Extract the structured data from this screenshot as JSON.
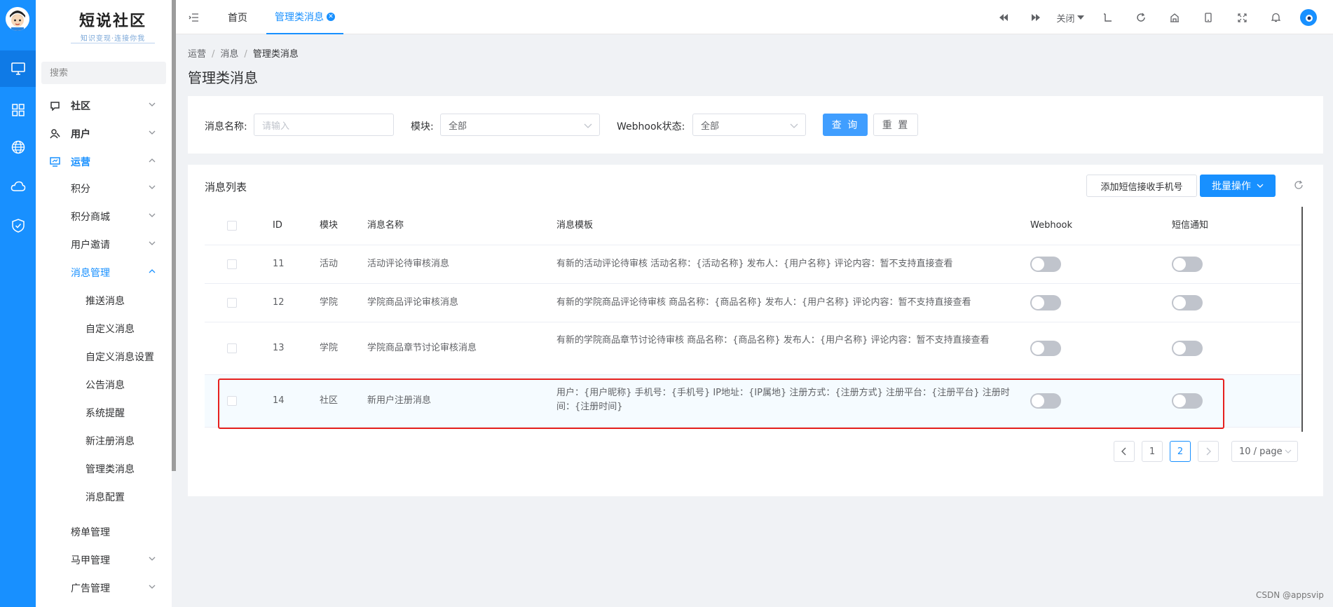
{
  "brand": {
    "title": "短说社区",
    "subtitle": "知识变现·连接你我"
  },
  "sidebar": {
    "search_placeholder": "搜索",
    "items": [
      {
        "label": "社区",
        "icon": "chat-icon",
        "level": 1
      },
      {
        "label": "用户",
        "icon": "user-icon",
        "level": 1
      },
      {
        "label": "运营",
        "icon": "monitor-icon",
        "level": 1,
        "active": true
      },
      {
        "label": "积分",
        "level": 2
      },
      {
        "label": "积分商城",
        "level": 2
      },
      {
        "label": "用户邀请",
        "level": 2
      },
      {
        "label": "消息管理",
        "level": 2,
        "active": true
      },
      {
        "label": "推送消息",
        "level": 3
      },
      {
        "label": "自定义消息",
        "level": 3
      },
      {
        "label": "自定义消息设置",
        "level": 3
      },
      {
        "label": "公告消息",
        "level": 3
      },
      {
        "label": "系统提醒",
        "level": 3
      },
      {
        "label": "新注册消息",
        "level": 3
      },
      {
        "label": "管理类消息",
        "level": 3,
        "selected": true
      },
      {
        "label": "消息配置",
        "level": 3
      },
      {
        "label": "榜单管理",
        "level": 2
      },
      {
        "label": "马甲管理",
        "level": 2
      },
      {
        "label": "广告管理",
        "level": 2
      }
    ]
  },
  "rail": {
    "icons": [
      "desktop-icon",
      "grid-icon",
      "globe-icon",
      "cloud-icon",
      "shield-icon"
    ]
  },
  "topbar": {
    "tabs": [
      {
        "label": "首页"
      },
      {
        "label": "管理类消息",
        "active": true
      }
    ],
    "close_label": "关闭",
    "tools": [
      "prev-icon",
      "next-icon",
      "close-dropdown",
      "back-icon",
      "refresh-icon",
      "home-icon",
      "mobile-icon",
      "fullscreen-icon",
      "bell-icon",
      "avatar"
    ]
  },
  "breadcrumb": [
    "运营",
    "消息",
    "管理类消息"
  ],
  "page_title": "管理类消息",
  "filters": {
    "name_label": "消息名称:",
    "name_placeholder": "请输入",
    "module_label": "模块:",
    "module_value": "全部",
    "webhook_label": "Webhook状态:",
    "webhook_value": "全部",
    "query_label": "查 询",
    "reset_label": "重 置"
  },
  "table_card": {
    "title": "消息列表",
    "add_sms_label": "添加短信接收手机号",
    "batch_label": "批量操作"
  },
  "table": {
    "columns": [
      "ID",
      "模块",
      "消息名称",
      "消息模板",
      "Webhook",
      "短信通知"
    ],
    "rows": [
      {
        "id": "11",
        "module": "活动",
        "name": "活动评论待审核消息",
        "template": "有新的活动评论待审核 活动名称：{活动名称} 发布人：{用户名称} 评论内容：暂不支持直接查看",
        "webhook": false,
        "sms": false
      },
      {
        "id": "12",
        "module": "学院",
        "name": "学院商品评论审核消息",
        "template": "有新的学院商品评论待审核 商品名称：{商品名称} 发布人：{用户名称} 评论内容：暂不支持直接查看",
        "webhook": false,
        "sms": false
      },
      {
        "id": "13",
        "module": "学院",
        "name": "学院商品章节讨论审核消息",
        "template": "有新的学院商品章节讨论待审核 商品名称：{商品名称} 发布人：{用户名称} 评论内容：暂不支持直接查看",
        "webhook": false,
        "sms": false
      },
      {
        "id": "14",
        "module": "社区",
        "name": "新用户注册消息",
        "template": "用户：{用户昵称} 手机号：{手机号} IP地址：{IP属地} 注册方式：{注册方式} 注册平台：{注册平台} 注册时间：{注册时间}",
        "webhook": false,
        "sms": false,
        "highlighted": true
      }
    ]
  },
  "pagination": {
    "pages": [
      "1",
      "2"
    ],
    "current": "2",
    "page_size": "10 / page"
  },
  "watermark": "CSDN @appsvip",
  "colors": {
    "primary": "#1890ff",
    "highlight_border": "#e6201e"
  }
}
